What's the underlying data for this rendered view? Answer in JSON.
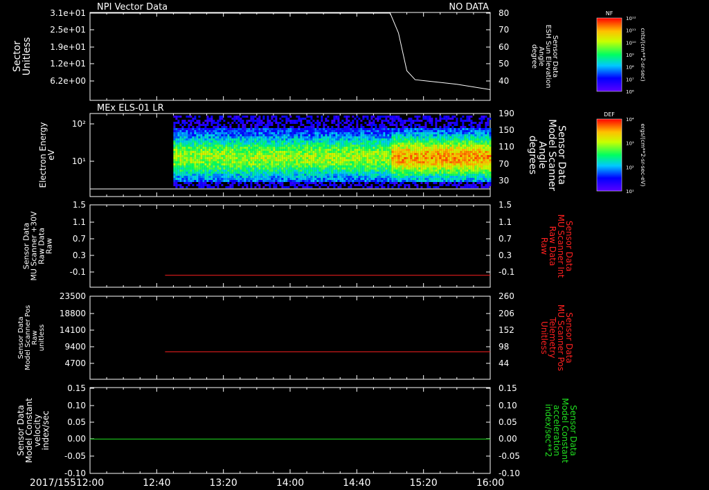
{
  "date_label": "2017/155",
  "x_ticks": [
    "12:00",
    "12:40",
    "13:20",
    "14:00",
    "14:40",
    "15:20",
    "16:00"
  ],
  "colors": {
    "bg": "#000000",
    "axis": "#ffffff",
    "red": "#ff2020",
    "green": "#20e020"
  },
  "chart_data": [
    {
      "type": "line",
      "title_left": "NPI Vector Data",
      "title_right": "NO DATA",
      "ylabel_left": [
        "Sector",
        "Unitless"
      ],
      "yticks_left": [
        "3.1e+01",
        "2.5e+01",
        "1.9e+01",
        "1.2e+01",
        "6.2e+00"
      ],
      "ylabel_right": [
        "Sensor Data",
        "ESH Sun Elevation",
        "Angle",
        "degree"
      ],
      "yticks_right": [
        "80",
        "70",
        "60",
        "50",
        "40"
      ],
      "y_right_range": [
        35,
        80
      ],
      "series_right": {
        "x": [
          "12:00",
          "15:00",
          "15:05",
          "15:10",
          "15:15",
          "15:20",
          "15:40",
          "16:00"
        ],
        "y": [
          80,
          80,
          69,
          48,
          43,
          42.5,
          40.5,
          37.5
        ]
      },
      "colorbar": {
        "label": "NF",
        "units": "cnts/(cm**2-sr-sec)",
        "ticks": [
          "10¹²",
          "10¹¹",
          "10¹⁰",
          "10⁹",
          "10⁸",
          "10⁷",
          "10⁶"
        ]
      }
    },
    {
      "type": "heatmap",
      "title_left": "MEx ELS-01 LR",
      "ylabel_left": [
        "Electron Energy",
        "eV"
      ],
      "yticks_left": [
        "10²",
        "10¹"
      ],
      "ylabel_right": [
        "Sensor Data",
        "Model Scanner",
        "Angle",
        "degrees"
      ],
      "yticks_right": [
        "190",
        "150",
        "110",
        "70",
        "30"
      ],
      "data_start": "12:50",
      "colorbar": {
        "label": "DEF",
        "units": "ergs/(cm**2-sr-sec-eV)",
        "ticks": [
          "10⁴",
          "10³",
          "10²",
          "10¹"
        ]
      }
    },
    {
      "type": "line",
      "ylabel_left": [
        "Sensor Data",
        "MU Scanner +30V",
        "Raw Data",
        "Raw"
      ],
      "yticks_left": [
        "1.5",
        "1.1",
        "0.7",
        "0.3",
        "-0.1"
      ],
      "ylabel_right": [
        "Sensor Data",
        "MU Scanner Int",
        "Raw Data",
        "Raw"
      ],
      "yticks_right": [
        "1.5",
        "1.1",
        "0.7",
        "0.3",
        "-0.1"
      ],
      "y_range": [
        -0.3,
        1.5
      ],
      "series": {
        "x": [
          "12:45",
          "16:00"
        ],
        "y": [
          -0.04,
          -0.04
        ]
      }
    },
    {
      "type": "line",
      "ylabel_left": [
        "Sensor Data",
        "Model Scanner Pos",
        "Raw",
        "unitless"
      ],
      "yticks_left": [
        "23500",
        "18800",
        "14100",
        "9400",
        "4700"
      ],
      "ylabel_right": [
        "Sensor Data",
        "MU Scanner Pos",
        "Telemetry",
        "Unitless"
      ],
      "yticks_right": [
        "260",
        "206",
        "152",
        "98",
        "44"
      ],
      "y_range": [
        0,
        23500
      ],
      "series": {
        "x": [
          "12:45",
          "16:00"
        ],
        "y": [
          7800,
          7800
        ]
      }
    },
    {
      "type": "line",
      "ylabel_left": [
        "Sensor Data",
        "Model Constant",
        "velocity",
        "index/sec"
      ],
      "yticks_left": [
        "0.15",
        "0.10",
        "0.05",
        "0.00",
        "-0.05",
        "-0.10"
      ],
      "ylabel_right": [
        "Sensor Data",
        "Model Constant",
        "acceleration",
        "index/sec**2"
      ],
      "yticks_right": [
        "0.15",
        "0.10",
        "0.05",
        "0.00",
        "-0.05",
        "-0.10"
      ],
      "y_range": [
        -0.1,
        0.15
      ],
      "series": {
        "x": [
          "12:00",
          "16:00"
        ],
        "y": [
          0.0,
          0.0
        ]
      }
    }
  ]
}
